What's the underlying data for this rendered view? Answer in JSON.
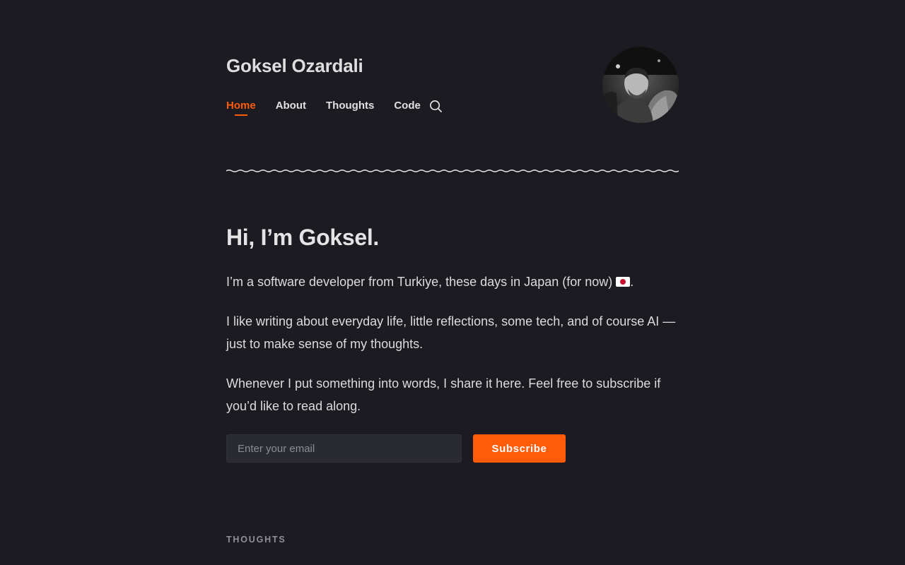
{
  "site": {
    "title": "Goksel Ozardali"
  },
  "nav": {
    "items": [
      {
        "label": "Home",
        "active": true
      },
      {
        "label": "About",
        "active": false
      },
      {
        "label": "Thoughts",
        "active": false
      },
      {
        "label": "Code",
        "active": false
      }
    ],
    "search_icon": "search-icon"
  },
  "avatar": {
    "icon": "profile-photo"
  },
  "hero": {
    "title": "Hi, I’m Goksel.",
    "p1_text": "I’m a software developer from Turkiye, these days in Japan (for now) ",
    "p1_flag": "japan-flag-emoji",
    "p1_end": ".",
    "p2": "I like writing about everyday life, little reflections, some tech, and of course AI — just to make sense of my thoughts.",
    "p3": "Whenever I put something into words, I share it here. Feel free to subscribe if you’d like to read along."
  },
  "subscribe": {
    "email_placeholder": "Enter your email",
    "email_value": "",
    "button_label": "Subscribe"
  },
  "sections": {
    "thoughts_label": "THOUGHTS"
  },
  "colors": {
    "background": "#1b1b21",
    "accent": "#ff5c0a",
    "text": "#e6e6e6",
    "muted": "#8f8f96"
  }
}
